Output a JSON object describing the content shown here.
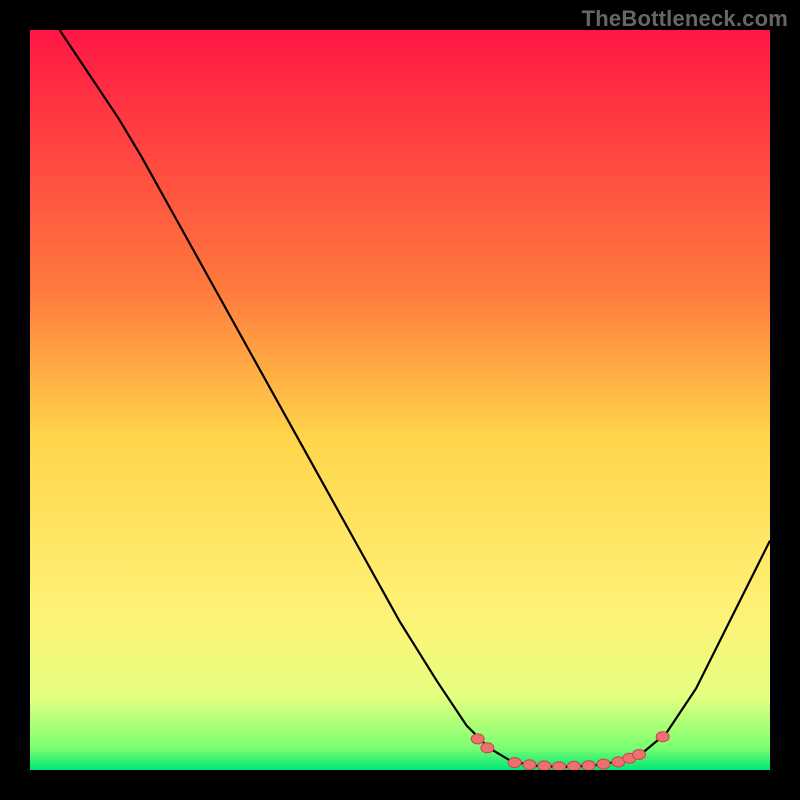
{
  "watermark": "TheBottleneck.com",
  "colors": {
    "black": "#000000",
    "curve": "#000000",
    "dot_fill": "#ef7070",
    "dot_stroke": "#c44848",
    "gradient_stops": [
      {
        "offset": "0%",
        "color": "#ff1744"
      },
      {
        "offset": "35%",
        "color": "#ff7a3d"
      },
      {
        "offset": "55%",
        "color": "#ffd54a"
      },
      {
        "offset": "78%",
        "color": "#fff176"
      },
      {
        "offset": "90%",
        "color": "#e6ff80"
      },
      {
        "offset": "97%",
        "color": "#7aff70"
      },
      {
        "offset": "100%",
        "color": "#00e676"
      }
    ]
  },
  "chart_data": {
    "type": "line",
    "title": "",
    "xlabel": "",
    "ylabel": "",
    "xlim": [
      0,
      100
    ],
    "ylim": [
      0,
      100
    ],
    "grid": false,
    "legend": false,
    "series": [
      {
        "name": "curve",
        "points": [
          {
            "x": 4,
            "y": 100
          },
          {
            "x": 8,
            "y": 94
          },
          {
            "x": 12,
            "y": 88
          },
          {
            "x": 15,
            "y": 83
          },
          {
            "x": 20,
            "y": 74
          },
          {
            "x": 25,
            "y": 65
          },
          {
            "x": 30,
            "y": 56
          },
          {
            "x": 35,
            "y": 47
          },
          {
            "x": 40,
            "y": 38
          },
          {
            "x": 45,
            "y": 29
          },
          {
            "x": 50,
            "y": 20
          },
          {
            "x": 55,
            "y": 12
          },
          {
            "x": 59,
            "y": 6
          },
          {
            "x": 62,
            "y": 3
          },
          {
            "x": 65,
            "y": 1.2
          },
          {
            "x": 68,
            "y": 0.6
          },
          {
            "x": 72,
            "y": 0.4
          },
          {
            "x": 76,
            "y": 0.6
          },
          {
            "x": 80,
            "y": 1.2
          },
          {
            "x": 83,
            "y": 2.5
          },
          {
            "x": 86,
            "y": 5
          },
          {
            "x": 90,
            "y": 11
          },
          {
            "x": 94,
            "y": 19
          },
          {
            "x": 98,
            "y": 27
          },
          {
            "x": 100,
            "y": 31
          }
        ]
      }
    ],
    "highlight_dots": [
      {
        "x": 60.5,
        "y": 4.2
      },
      {
        "x": 61.8,
        "y": 3.0
      },
      {
        "x": 65.5,
        "y": 1.0
      },
      {
        "x": 67.5,
        "y": 0.7
      },
      {
        "x": 69.5,
        "y": 0.55
      },
      {
        "x": 71.5,
        "y": 0.45
      },
      {
        "x": 73.5,
        "y": 0.5
      },
      {
        "x": 75.5,
        "y": 0.6
      },
      {
        "x": 77.5,
        "y": 0.8
      },
      {
        "x": 79.5,
        "y": 1.1
      },
      {
        "x": 81.0,
        "y": 1.6
      },
      {
        "x": 82.3,
        "y": 2.1
      },
      {
        "x": 85.5,
        "y": 4.5
      }
    ]
  }
}
